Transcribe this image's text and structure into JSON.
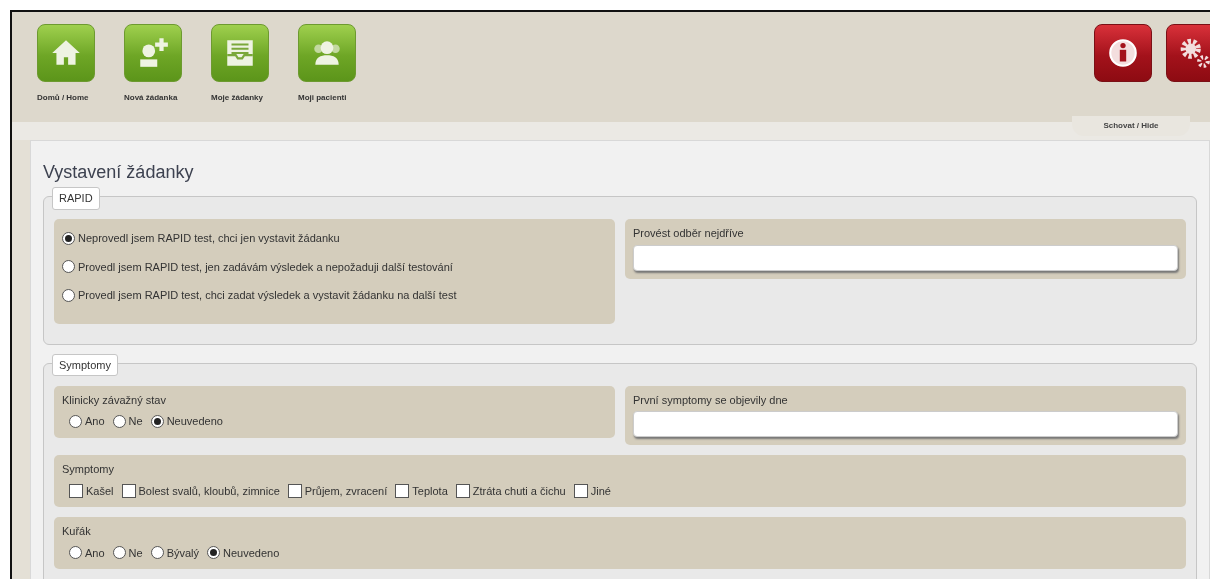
{
  "nav": [
    {
      "kind": "home",
      "label": "Domů / Home"
    },
    {
      "kind": "new",
      "label": "Nová žádanka"
    },
    {
      "kind": "list",
      "label": "Moje žádanky"
    },
    {
      "kind": "patients",
      "label": "Moji pacienti"
    }
  ],
  "tools": [
    {
      "kind": "info"
    },
    {
      "kind": "settings"
    }
  ],
  "hide_label": "Schovat / Hide",
  "title": "Vystavení žádanky",
  "sections": [
    {
      "legend": "RAPID",
      "rows": [
        [
          {
            "kind": "radiolist",
            "options": [
              {
                "label": "Neprovedl jsem RAPID test, chci jen vystavit žádanku",
                "selected": true
              },
              {
                "label": "Provedl jsem RAPID test, jen zadávám výsledek a nepožaduji další testování",
                "selected": false
              },
              {
                "label": "Provedl jsem RAPID test, chci zadat výsledek a vystavit žádanku na další test",
                "selected": false
              }
            ]
          },
          {
            "kind": "input",
            "label": "Provést odběr nejdříve"
          }
        ]
      ]
    },
    {
      "legend": "Symptomy",
      "rows": [
        [
          {
            "kind": "radio",
            "label": "Klinicky závažný stav",
            "options": [
              {
                "label": "Ano",
                "selected": false
              },
              {
                "label": "Ne",
                "selected": false
              },
              {
                "label": "Neuvedeno",
                "selected": true
              }
            ]
          },
          {
            "kind": "input",
            "label": "První symptomy se objevily dne"
          }
        ],
        [
          {
            "kind": "checkbox",
            "label": "Symptomy",
            "options": [
              {
                "label": "Kašel",
                "checked": false
              },
              {
                "label": "Bolest svalů, kloubů, zimnice",
                "checked": false
              },
              {
                "label": "Průjem, zvracení",
                "checked": false
              },
              {
                "label": "Teplota",
                "checked": false
              },
              {
                "label": "Ztráta chuti a čichu",
                "checked": false
              },
              {
                "label": "Jiné",
                "checked": false
              }
            ]
          }
        ],
        [
          {
            "kind": "radio",
            "label": "Kuřák",
            "options": [
              {
                "label": "Ano",
                "selected": false
              },
              {
                "label": "Ne",
                "selected": false
              },
              {
                "label": "Bývalý",
                "selected": false
              },
              {
                "label": "Neuvedeno",
                "selected": true
              }
            ]
          }
        ]
      ]
    }
  ]
}
